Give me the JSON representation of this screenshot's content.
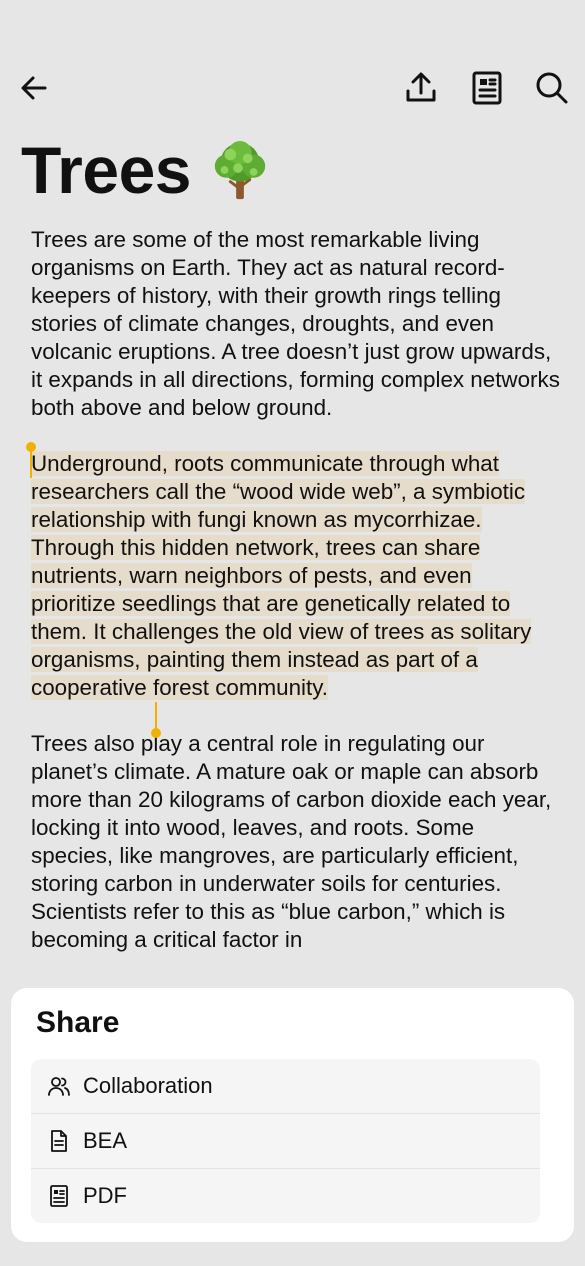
{
  "title": "Trees",
  "title_emoji": "tree-emoji",
  "paragraphs": {
    "p1": "Trees are some of the most remarkable living organisms on Earth. They act as natural record-keepers of history, with their growth rings telling stories of climate changes, droughts, and even volcanic eruptions. A tree doesn’t just grow upwards, it expands in all directions, forming complex networks both above and below ground.",
    "p2": "Underground, roots communicate through what researchers call the “wood wide web”, a symbiotic relationship with fungi known as mycorrhizae. Through this hidden network, trees can share nutrients, warn neighbors of pests, and even prioritize seedlings that are genetically related to them. It challenges the old view of trees as solitary organisms, painting them instead as part of a cooperative forest community.",
    "p3": "Trees also play a central role in regulating our planet’s climate. A mature oak or maple can absorb more than 20 kilograms of carbon dioxide each year, locking it into wood, leaves, and roots. Some species, like mangroves, are particularly efficient, storing carbon in underwater soils for centuries. Scientists refer to this as “blue carbon,” which is becoming a critical factor in"
  },
  "selection_color": "#e6dccb",
  "handle_color": "#f2b100",
  "toolbar_icons": [
    "arrow-left-icon",
    "share-upload-icon",
    "reader-view-icon",
    "search-icon"
  ],
  "share_sheet": {
    "title": "Share",
    "items": [
      {
        "icon": "users-icon",
        "label": "Collaboration"
      },
      {
        "icon": "document-icon",
        "label": "BEA"
      },
      {
        "icon": "pdf-icon",
        "label": "PDF"
      }
    ]
  }
}
